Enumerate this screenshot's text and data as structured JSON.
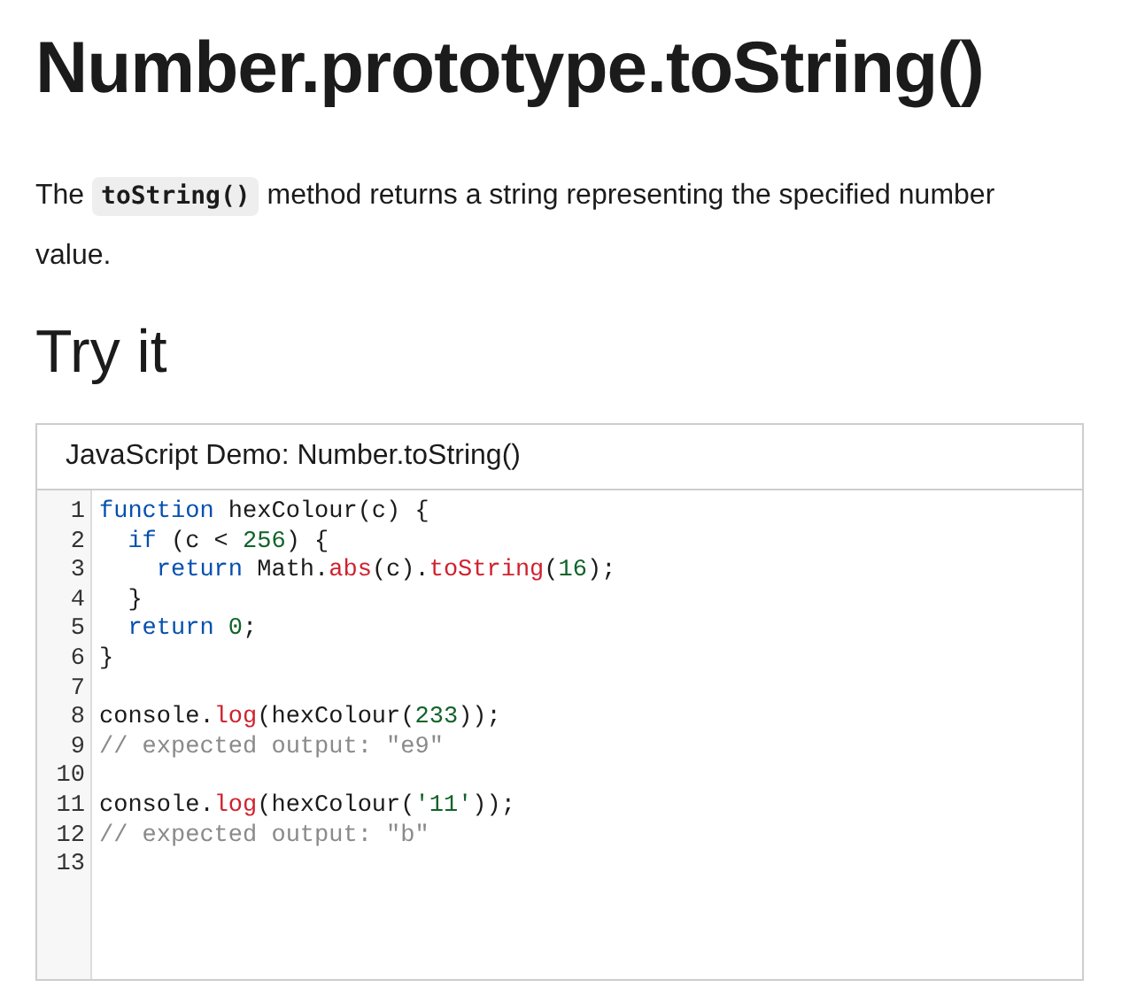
{
  "title": "Number.prototype.toString()",
  "intro": {
    "before": "The ",
    "code": "toString()",
    "after": " method returns a string representing the specified number value."
  },
  "section_heading": "Try it",
  "demo": {
    "header": "JavaScript Demo: Number.toString()",
    "lines": [
      {
        "number": "1",
        "tokens": [
          {
            "text": "function",
            "kind": "keyword"
          },
          {
            "text": " hexColour(c) {",
            "kind": "plain"
          }
        ]
      },
      {
        "number": "2",
        "tokens": [
          {
            "text": "  if",
            "kind": "keyword"
          },
          {
            "text": " (c < ",
            "kind": "plain"
          },
          {
            "text": "256",
            "kind": "number"
          },
          {
            "text": ") {",
            "kind": "plain"
          }
        ]
      },
      {
        "number": "3",
        "tokens": [
          {
            "text": "    return",
            "kind": "keyword"
          },
          {
            "text": " Math.",
            "kind": "plain"
          },
          {
            "text": "abs",
            "kind": "method"
          },
          {
            "text": "(c).",
            "kind": "plain"
          },
          {
            "text": "toString",
            "kind": "method"
          },
          {
            "text": "(",
            "kind": "plain"
          },
          {
            "text": "16",
            "kind": "number"
          },
          {
            "text": ");",
            "kind": "plain"
          }
        ]
      },
      {
        "number": "4",
        "tokens": [
          {
            "text": "  }",
            "kind": "plain"
          }
        ]
      },
      {
        "number": "5",
        "tokens": [
          {
            "text": "  return",
            "kind": "keyword"
          },
          {
            "text": " 0",
            "kind": "number"
          },
          {
            "text": ";",
            "kind": "plain"
          }
        ]
      },
      {
        "number": "6",
        "tokens": [
          {
            "text": "}",
            "kind": "plain"
          }
        ]
      },
      {
        "number": "7"
      },
      {
        "number": "8",
        "tokens": [
          {
            "text": "console.",
            "kind": "plain"
          },
          {
            "text": "log",
            "kind": "method"
          },
          {
            "text": "(hexColour(",
            "kind": "plain"
          },
          {
            "text": "233",
            "kind": "number"
          },
          {
            "text": "));",
            "kind": "plain"
          }
        ]
      },
      {
        "number": "9",
        "tokens": [
          {
            "text": "// expected output: \"e9\"",
            "kind": "comment"
          }
        ]
      },
      {
        "number": "10"
      },
      {
        "number": "11",
        "tokens": [
          {
            "text": "console.",
            "kind": "plain"
          },
          {
            "text": "log",
            "kind": "method"
          },
          {
            "text": "(hexColour(",
            "kind": "plain"
          },
          {
            "text": "'11'",
            "kind": "string"
          },
          {
            "text": "));",
            "kind": "plain"
          }
        ]
      },
      {
        "number": "12",
        "tokens": [
          {
            "text": "// expected output: \"b\"",
            "kind": "comment"
          }
        ]
      },
      {
        "number": "13"
      }
    ]
  }
}
